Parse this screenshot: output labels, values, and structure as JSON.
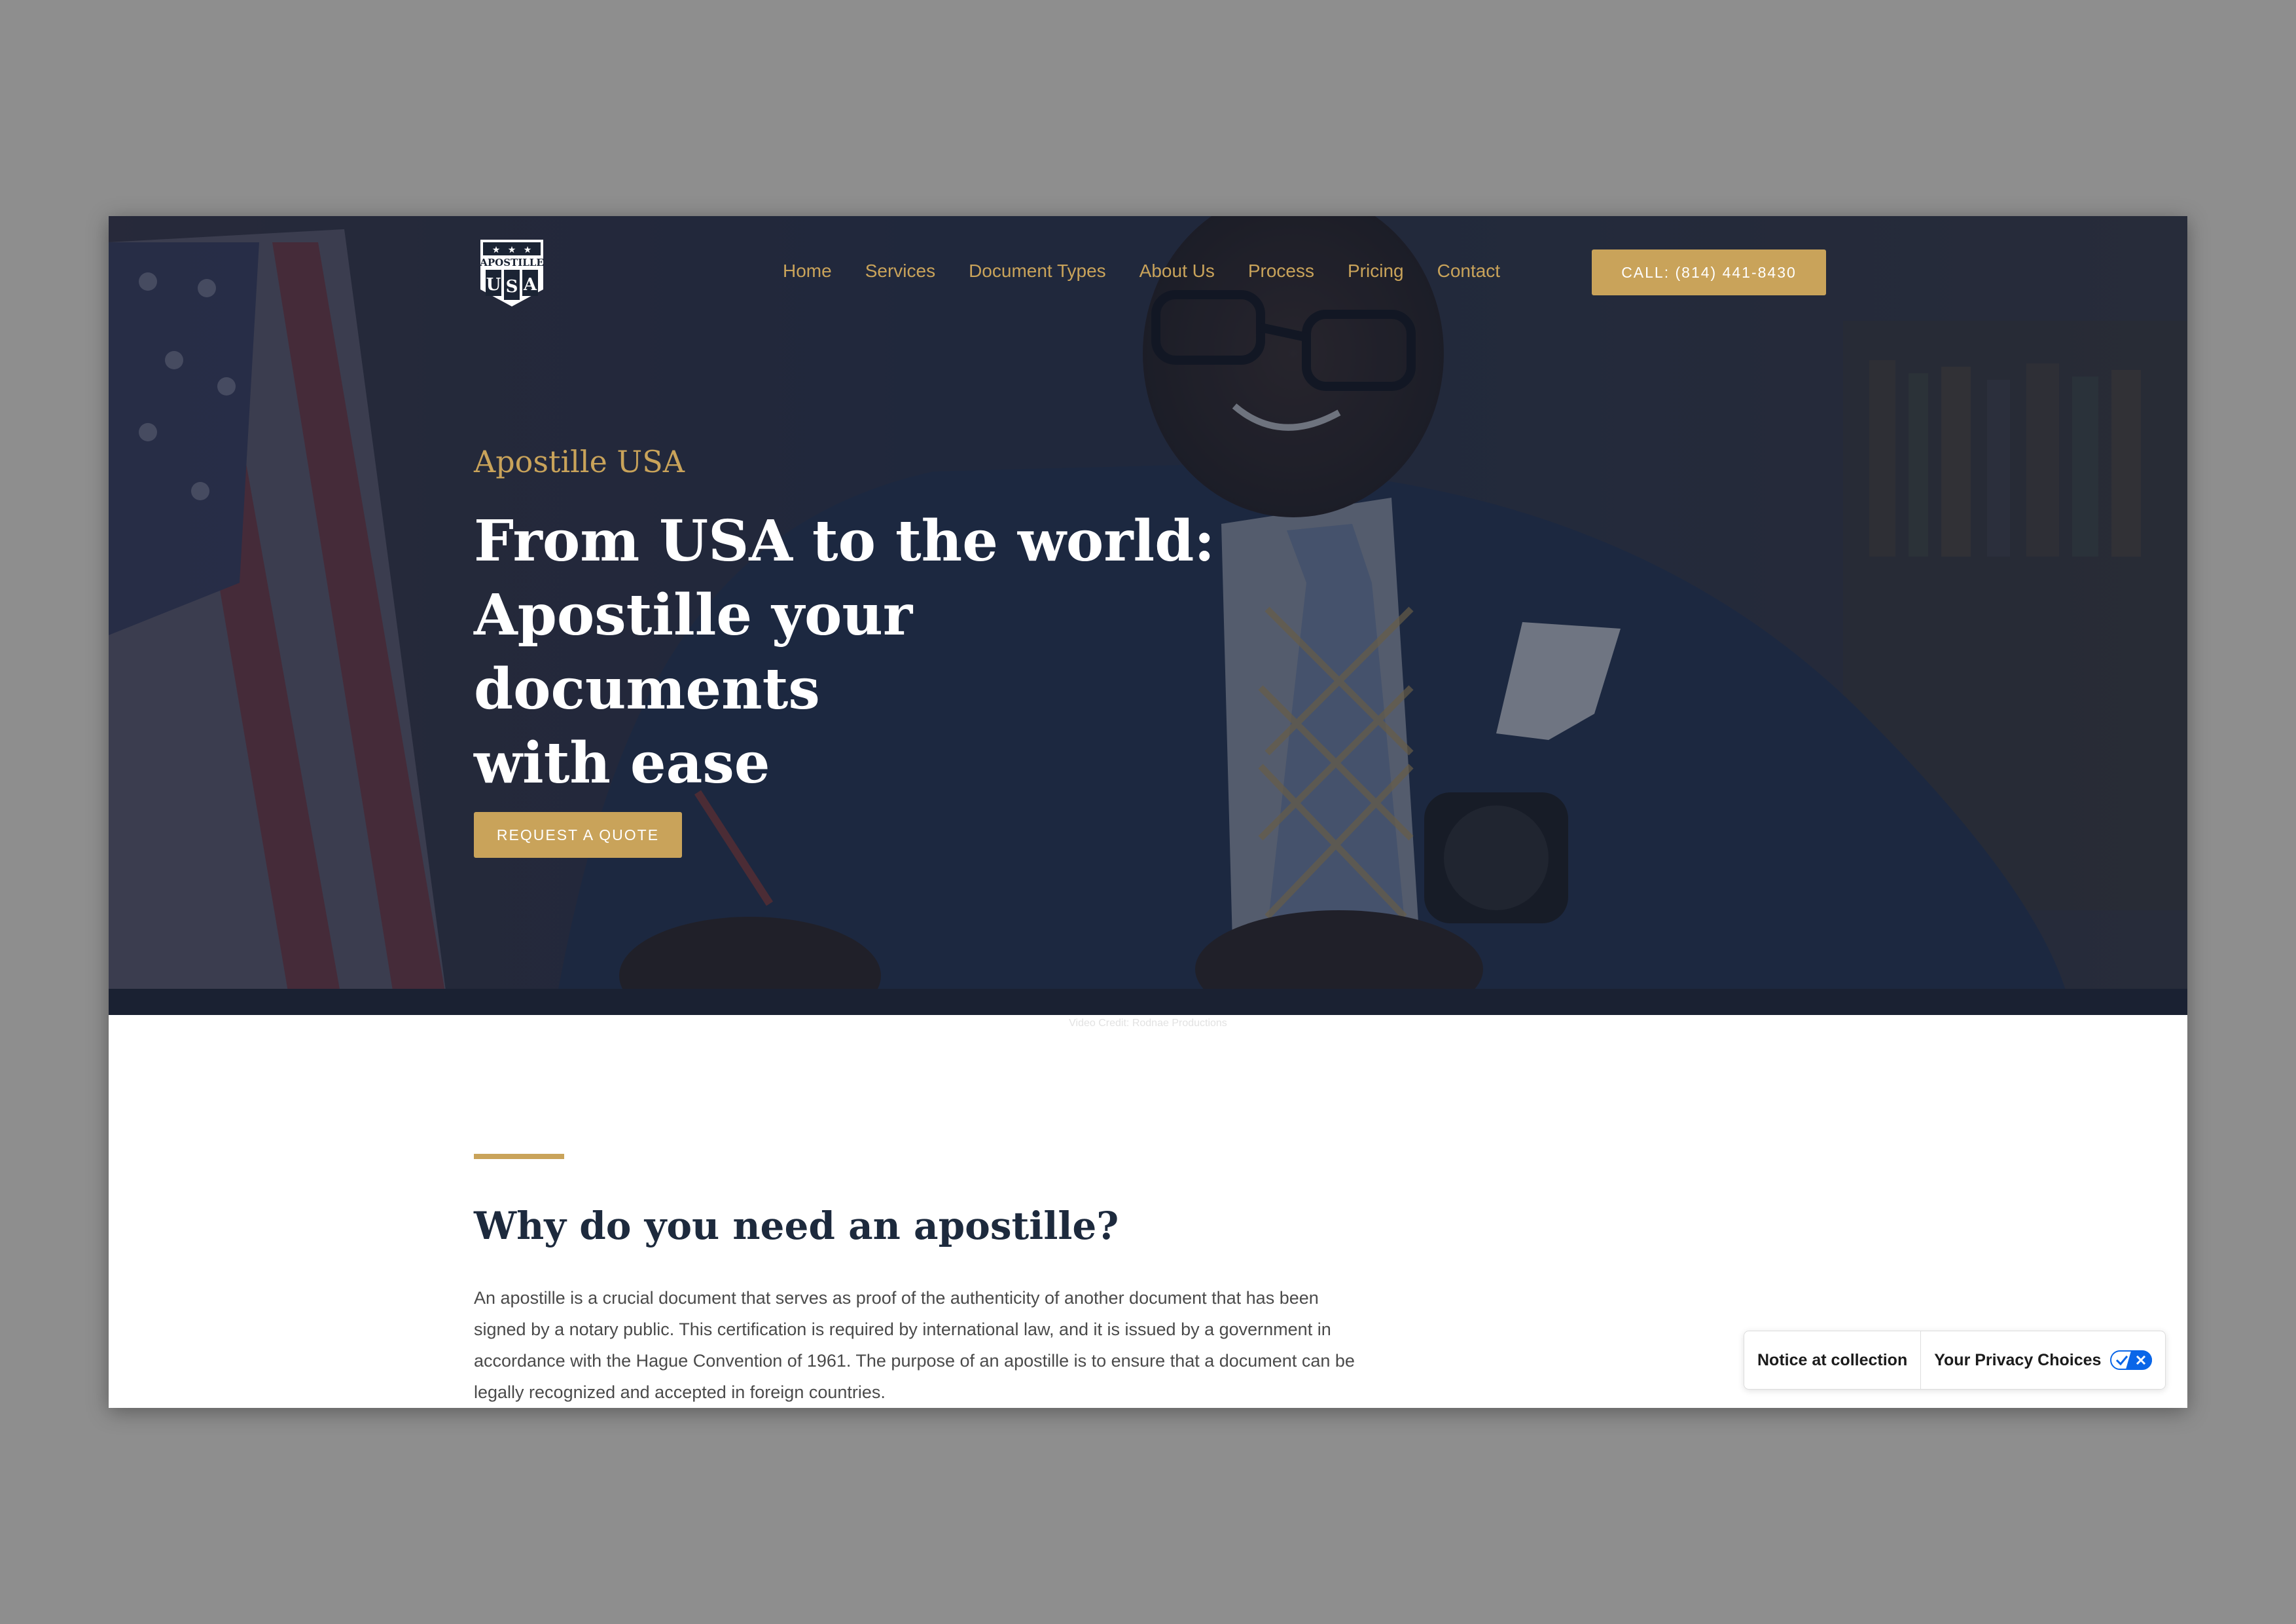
{
  "header": {
    "logo": {
      "top": "APOSTILLE",
      "letters": [
        "U",
        "S",
        "A"
      ]
    },
    "nav": [
      "Home",
      "Services",
      "Document Types",
      "About Us",
      "Process",
      "Pricing",
      "Contact"
    ],
    "call_label": "CALL: (814) 441-8430"
  },
  "hero": {
    "eyebrow": "Apostille USA",
    "title_lines": [
      "From USA to the world:",
      "Apostille your documents",
      "with ease"
    ],
    "cta_label": "REQUEST A QUOTE",
    "video_credit": "Video Credit: Rodnae Productions"
  },
  "section": {
    "title": "Why do you need an apostille?",
    "body_lines": [
      "An apostille is a crucial document that serves as proof of the authenticity of another document that has been",
      "signed by a notary public. This certification is required by international law, and it is issued by a government in",
      "accordance with the Hague Convention of 1961. The purpose of an apostille is to ensure that a document can be",
      "legally recognized and accepted in foreign countries."
    ]
  },
  "privacy": {
    "notice_label": "Notice at collection",
    "choices_label": "Your Privacy Choices"
  },
  "colors": {
    "accent": "#c9a35a",
    "hero_overlay": "#182134",
    "heading": "#1d2a3d",
    "body_text": "#4a4a4a",
    "toggle_blue": "#0a66e8"
  }
}
